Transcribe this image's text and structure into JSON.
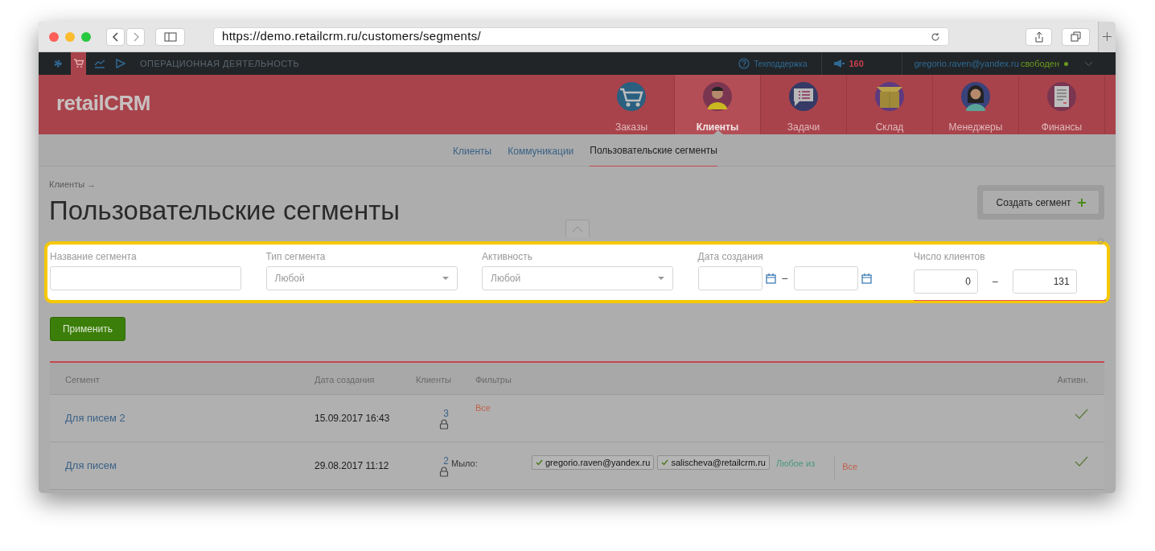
{
  "browser": {
    "url": "https://demo.retailcrm.ru/customers/segments/"
  },
  "topbar": {
    "apps": [
      {
        "selected": false
      },
      {
        "selected": true
      },
      {
        "selected": false
      },
      {
        "selected": false
      }
    ],
    "section": "ОПЕРАЦИОННАЯ ДЕЯТЕЛЬНОСТЬ",
    "support": "Техподдержка",
    "notifications": "160",
    "user": "gregorio.raven@yandex.ru",
    "status": "свободен"
  },
  "header": {
    "logo": "retailCRM",
    "nav": [
      {
        "label": "Заказы",
        "selected": false
      },
      {
        "label": "Клиенты",
        "selected": true
      },
      {
        "label": "Задачи",
        "selected": false
      },
      {
        "label": "Склад",
        "selected": false
      },
      {
        "label": "Менеджеры",
        "selected": false
      },
      {
        "label": "Финансы",
        "selected": false
      }
    ]
  },
  "subnav": [
    {
      "label": "Клиенты",
      "selected": false
    },
    {
      "label": "Коммуникации",
      "selected": false
    },
    {
      "label": "Пользовательские сегменты",
      "selected": true
    }
  ],
  "breadcrumb": "Клиенты →",
  "title": "Пользовательские сегменты",
  "create_button": "Создать сегмент",
  "filters": [
    {
      "kind": "text",
      "label": "Название сегмента"
    },
    {
      "kind": "select",
      "label": "Тип сегмента",
      "value": "Любой"
    },
    {
      "kind": "select",
      "label": "Активность",
      "value": "Любой"
    },
    {
      "kind": "date_range",
      "label": "Дата создания",
      "separator": "–"
    },
    {
      "kind": "number_range",
      "label": "Число клиентов",
      "from": "0",
      "separator": "–",
      "to": "131"
    }
  ],
  "apply_button": "Применить",
  "table": {
    "columns": [
      "Сегмент",
      "Дата создания",
      "Клиенты",
      "Фильтры",
      "Активн."
    ],
    "rows": [
      {
        "name": "Для писем 2",
        "date": "15.09.2017 16:43",
        "clients": "3",
        "locked": true,
        "filters": {
          "scope": "Все"
        },
        "active": true
      },
      {
        "name": "Для писем",
        "date": "29.08.2017 11:12",
        "clients": "2",
        "locked": true,
        "filters": {
          "groups": [
            {
              "label": "Мыло:",
              "values": [
                "gregorio.raven@yandex.ru",
                "salischeva@retailcrm.ru"
              ],
              "mode": "Любое из"
            }
          ],
          "scope": "Все"
        },
        "active": true
      }
    ]
  }
}
